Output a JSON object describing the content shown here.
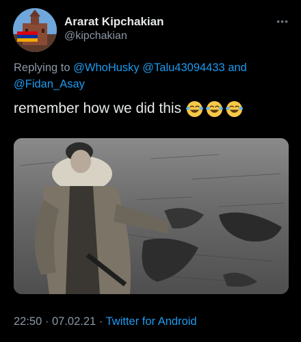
{
  "tweet": {
    "display_name": "Ararat Kipchakian",
    "handle": "@kipchakian",
    "reply_prefix": "Replying to",
    "mentions": [
      "@WhoHusky",
      "@Talu43094433",
      "@Fidan_Asay"
    ],
    "reply_joiner": "and",
    "text": "remember how we did this",
    "emojis": [
      "face-with-tears-of-joy",
      "face-with-tears-of-joy",
      "face-with-tears-of-joy"
    ],
    "time": "22:50",
    "date": "07.02.21",
    "separator": "·",
    "source": "Twitter for Android"
  },
  "icons": {
    "more": "more-options-icon"
  },
  "colors": {
    "background": "#000000",
    "text": "#e7e9ea",
    "secondary": "#8b98a5",
    "link": "#1d9bf0"
  }
}
